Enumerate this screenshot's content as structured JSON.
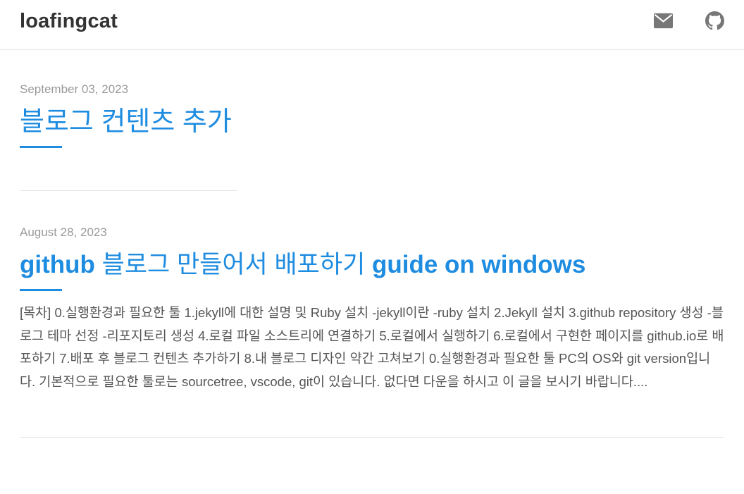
{
  "header": {
    "brand": "loafingcat",
    "icons": [
      "envelope-icon",
      "github-icon"
    ]
  },
  "posts": [
    {
      "date": "September 03, 2023",
      "title": "블로그 컨텐츠 추가"
    },
    {
      "date": "August 28, 2023",
      "title_parts": {
        "p1": "github ",
        "p2": "블로그 만들어서 배포하기",
        "p3": " guide on windows"
      },
      "excerpt": "[목차] 0.실행환경과 필요한 툴 1.jekyll에 대한 설명 및 Ruby 설치 -jekyll이란 -ruby 설치 2.Jekyll 설치 3.github repository 생성 -블로그 테마 선정 -리포지토리 생성 4.로컬 파일 소스트리에 연결하기 5.로컬에서 실행하기 6.로컬에서 구현한 페이지를 github.io로 배포하기 7.배포 후 블로그 컨텐츠 추가하기 8.내 블로그 디자인 약간 고쳐보기 0.실행환경과 필요한 툴 PC의 OS와 git version입니다. 기본적으로 필요한 툴로는 sourcetree, vscode, git이 있습니다. 없다면 다운을 하시고 이 글을 보시기 바랍니다...."
    }
  ],
  "colors": {
    "accent": "#1e8ce0",
    "date": "#9a9a9a",
    "text": "#555555",
    "icon": "#777777"
  }
}
